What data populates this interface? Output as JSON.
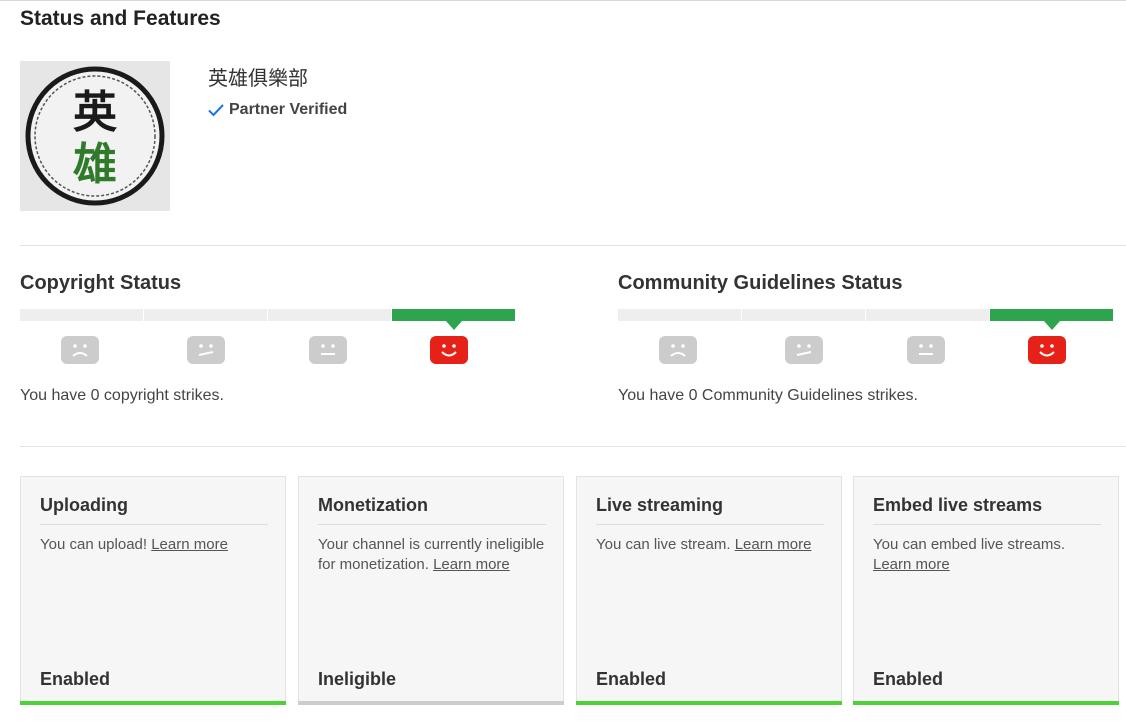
{
  "page_title": "Status and Features",
  "channel": {
    "name": "英雄俱樂部",
    "verified_label": "Partner Verified",
    "avatar_text": [
      "英",
      "雄"
    ]
  },
  "copyright": {
    "title": "Copyright Status",
    "strike_text": "You have 0 copyright strikes.",
    "level": 4,
    "levels": 4
  },
  "community": {
    "title": "Community Guidelines Status",
    "strike_text": "You have 0 Community Guidelines strikes.",
    "level": 4,
    "levels": 4
  },
  "features": [
    {
      "title": "Uploading",
      "desc": "You can upload!",
      "link": "Learn more",
      "state": "Enabled",
      "bar_color": "#4cd137"
    },
    {
      "title": "Monetization",
      "desc": "Your channel is currently ineligible for monetization.",
      "link": "Learn more",
      "state": "Ineligible",
      "bar_color": "#cccccc"
    },
    {
      "title": "Live streaming",
      "desc": "You can live stream.",
      "link": "Learn more",
      "state": "Enabled",
      "bar_color": "#4cd137"
    },
    {
      "title": "Embed live streams",
      "desc": "You can embed live streams.",
      "link": "Learn more",
      "state": "Enabled",
      "bar_color": "#4cd137"
    }
  ],
  "colors": {
    "good": "#2ea44f",
    "alert_face": "#e62117",
    "inactive_face": "#cccccc",
    "verified_check": "#1a73e8"
  }
}
